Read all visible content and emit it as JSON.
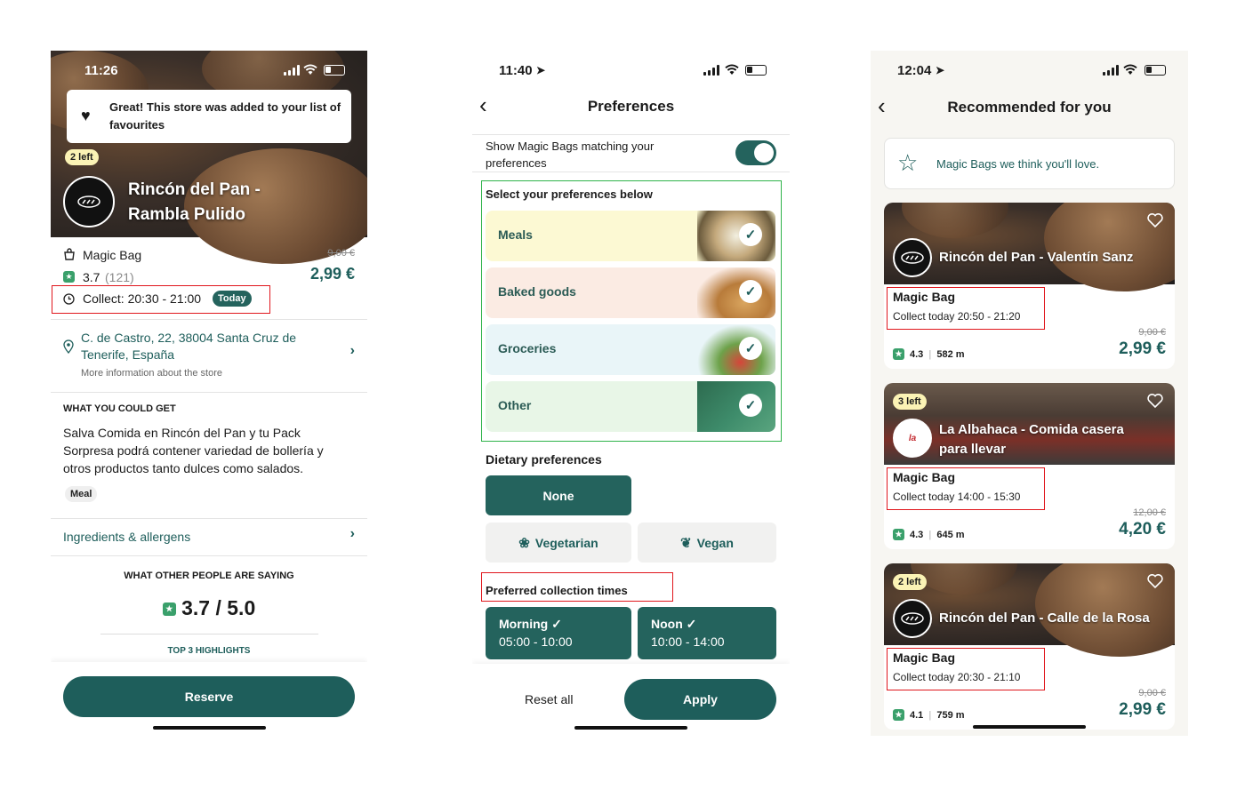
{
  "screen1": {
    "status_time": "11:26",
    "toast_text": "Great! This store was added to your list of favourites",
    "left_badge": "2 left",
    "store_name_line1": "Rincón del Pan -",
    "store_name_line2": "Rambla Pulido",
    "bag_label": "Magic Bag",
    "rating": "3.7",
    "rating_count": "(121)",
    "old_price": "9,00 €",
    "price": "2,99 €",
    "collect_label": "Collect: 20:30 - 21:00",
    "today_badge": "Today",
    "address_line1": "C. de Castro, 22, 38004 Santa Cruz de",
    "address_line2": "Tenerife, España",
    "more_info": "More information about the store",
    "what_get_heading": "WHAT YOU COULD GET",
    "description": "Salva Comida en Rincón del Pan y tu Pack Sorpresa podrá contener variedad de bollería y otros productos tanto dulces como salados.",
    "meal_tag": "Meal",
    "ingredients_link": "Ingredients & allergens",
    "others_heading": "WHAT OTHER PEOPLE ARE SAYING",
    "score": "3.7 / 5.0",
    "highlights": "TOP 3 HIGHLIGHTS",
    "reserve_button": "Reserve"
  },
  "screen2": {
    "status_time": "11:40",
    "title": "Preferences",
    "toggle_label": "Show Magic Bags matching your preferences",
    "toggle_on": true,
    "select_heading": "Select your preferences below",
    "tiles": [
      {
        "label": "Meals",
        "color": "#fcf9d3"
      },
      {
        "label": "Baked goods",
        "color": "#fbebe3"
      },
      {
        "label": "Groceries",
        "color": "#e9f5f8"
      },
      {
        "label": "Other",
        "color": "#e8f6e7"
      }
    ],
    "dietary_heading": "Dietary preferences",
    "diet_none": "None",
    "diet_vegetarian": "Vegetarian",
    "diet_vegan": "Vegan",
    "collection_heading": "Preferred collection times",
    "morning_label": "Morning ✓",
    "morning_time": "05:00 - 10:00",
    "noon_label": "Noon ✓",
    "noon_time": "10:00 - 14:00",
    "reset_button": "Reset all",
    "apply_button": "Apply"
  },
  "screen3": {
    "status_time": "12:04",
    "title": "Recommended for you",
    "banner_text": "Magic Bags we think you'll love.",
    "cards": [
      {
        "badge": "",
        "name_line1": "Rincón del Pan - Valentín Sanz",
        "name_line2": "",
        "bag": "Magic Bag",
        "collect": "Collect today 20:50 - 21:20",
        "rating": "4.3",
        "distance": "582 m",
        "old_price": "9,00 €",
        "price": "2,99 €"
      },
      {
        "badge": "3 left",
        "name_line1": "La Albahaca - Comida casera",
        "name_line2": "para llevar",
        "bag": "Magic Bag",
        "collect": "Collect today 14:00 - 15:30",
        "rating": "4.3",
        "distance": "645 m",
        "old_price": "12,00 €",
        "price": "4,20 €"
      },
      {
        "badge": "2 left",
        "name_line1": "Rincón del Pan - Calle de la Rosa",
        "name_line2": "",
        "bag": "Magic Bag",
        "collect": "Collect today 20:30 - 21:10",
        "rating": "4.1",
        "distance": "759 m",
        "old_price": "9,00 €",
        "price": "2,99 €"
      }
    ]
  }
}
